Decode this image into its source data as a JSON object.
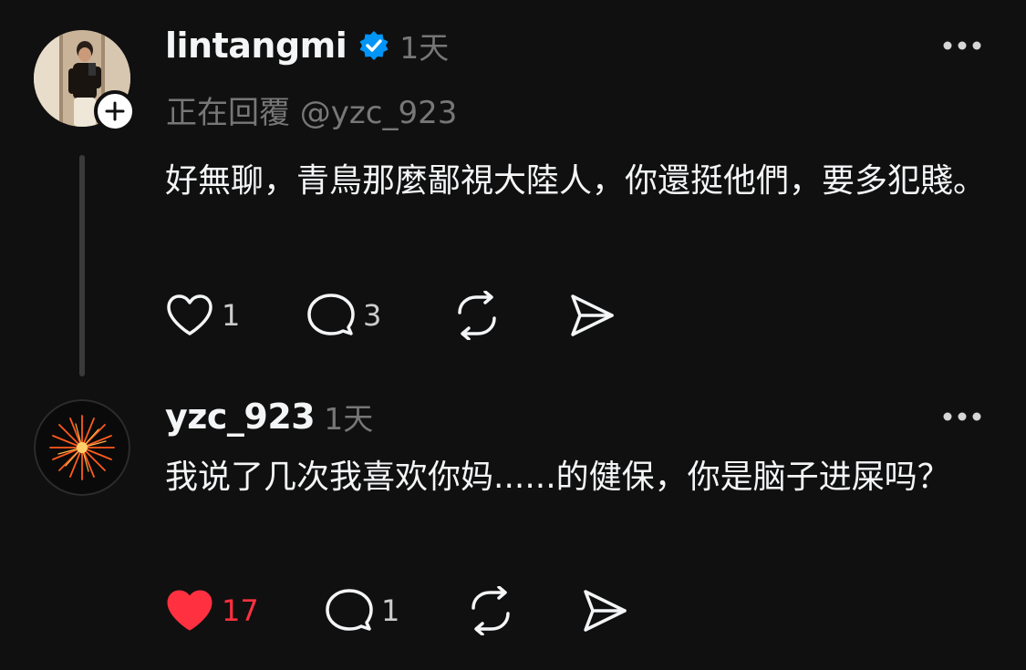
{
  "colors": {
    "background": "#101010",
    "text": "#f3f5f7",
    "muted": "#777777",
    "verified": "#0095f6",
    "liked": "#ff3040"
  },
  "posts": [
    {
      "username": "lintangmi",
      "verified": true,
      "time": "1天",
      "replying_to": "正在回覆 @yzc_923",
      "text": "好無聊，青鳥那麼鄙視大陸人，你還挺他們，要多犯賤。",
      "likes": "1",
      "liked": false,
      "comments": "3",
      "icons": [
        "heart-icon",
        "comment-icon",
        "repost-icon",
        "share-icon",
        "more-icon",
        "plus-icon",
        "verified-icon"
      ]
    },
    {
      "username": "yzc_923",
      "verified": false,
      "time": "1天",
      "text": "我说了几次我喜欢你妈......的健保，你是脑子进屎吗？",
      "likes": "17",
      "liked": true,
      "comments": "1",
      "icons": [
        "heart-filled-icon",
        "comment-icon",
        "repost-icon",
        "share-icon",
        "more-icon"
      ]
    }
  ]
}
